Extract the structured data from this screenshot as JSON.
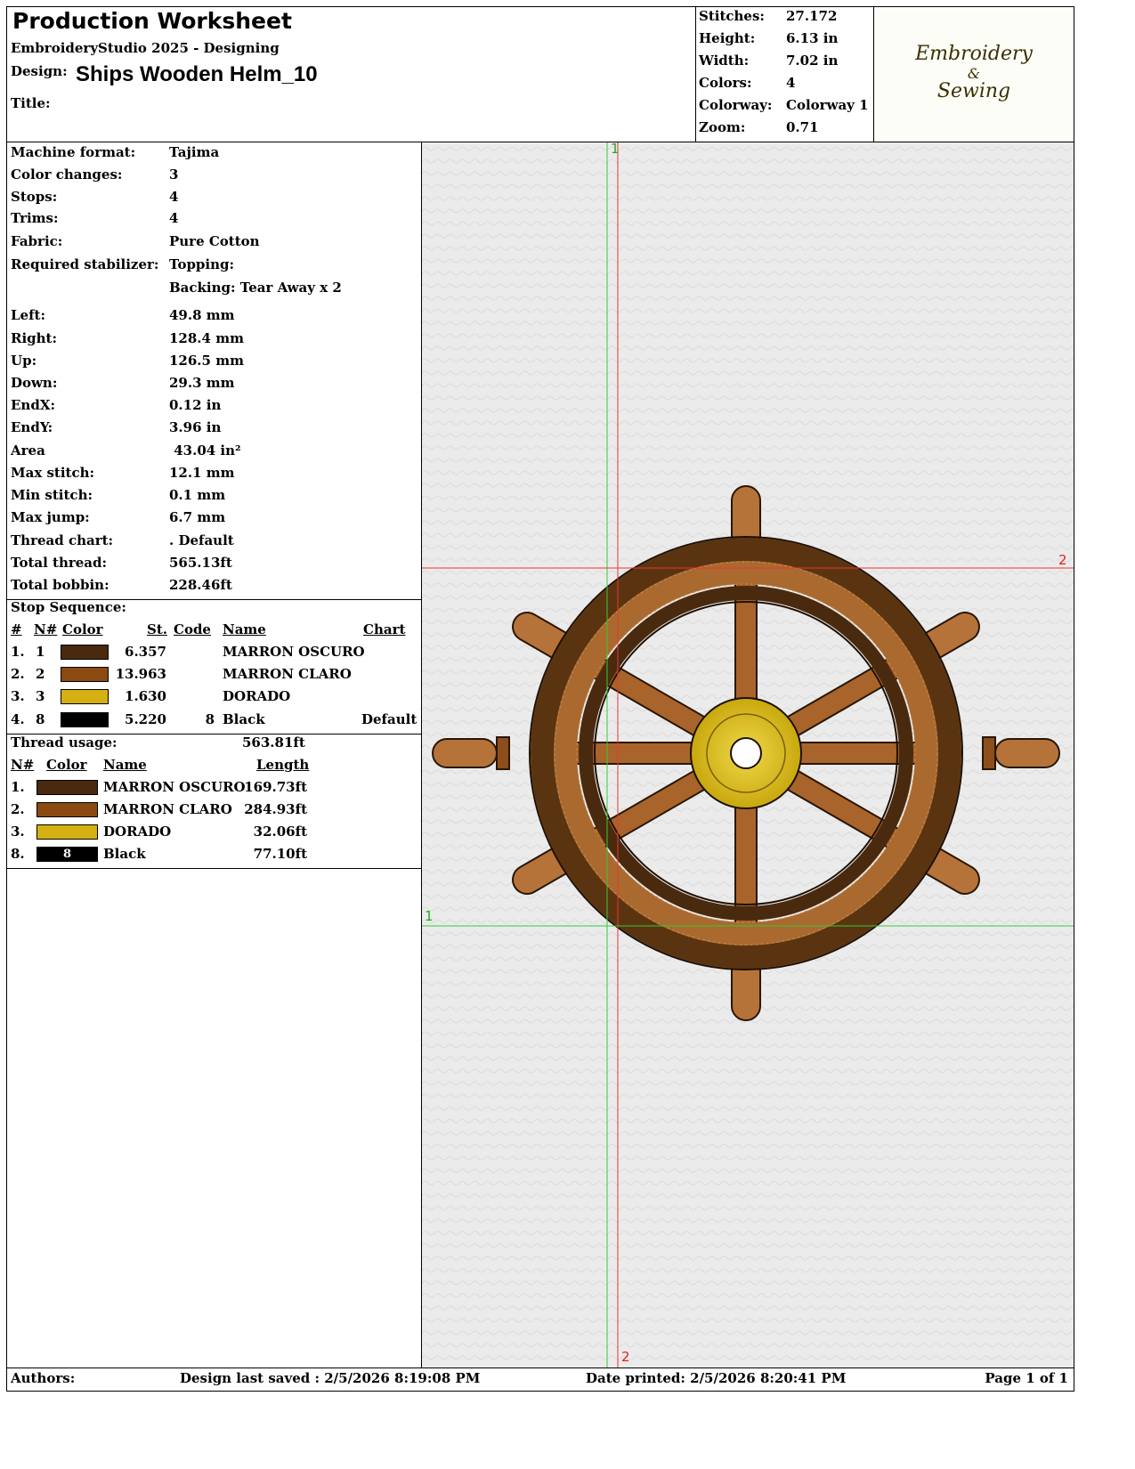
{
  "header": {
    "title": "Production Worksheet",
    "software": "EmbroideryStudio 2025 - Designing",
    "design_label": "Design:",
    "design_name": "Ships Wooden Helm_10",
    "title_label": "Title:",
    "title_value": ""
  },
  "summary": [
    {
      "label": "Stitches:",
      "value": "27.172"
    },
    {
      "label": "Height:",
      "value": "6.13 in"
    },
    {
      "label": "Width:",
      "value": "7.02 in"
    },
    {
      "label": "Colors:",
      "value": "4"
    },
    {
      "label": "Colorway:",
      "value": "Colorway 1"
    },
    {
      "label": "Zoom:",
      "value": "0.71"
    }
  ],
  "logo": {
    "line1": "Embroidery",
    "line2": "&",
    "line3": "Sewing"
  },
  "details": [
    {
      "label": "Machine format:",
      "value": "Tajima"
    },
    {
      "label": "Color changes:",
      "value": "3"
    },
    {
      "label": "Stops:",
      "value": "4"
    },
    {
      "label": "Trims:",
      "value": "4"
    },
    {
      "label": "Fabric:",
      "value": "Pure Cotton"
    },
    {
      "label": "Required stabilizer:",
      "value": "Topping:"
    },
    {
      "label": "",
      "value": "Backing: Tear Away x 2"
    },
    {
      "label": "Left:",
      "value": "49.8 mm"
    },
    {
      "label": "Right:",
      "value": "128.4 mm"
    },
    {
      "label": "Up:",
      "value": "126.5 mm"
    },
    {
      "label": "Down:",
      "value": "29.3 mm"
    },
    {
      "label": "EndX:",
      "value": "0.12 in"
    },
    {
      "label": "EndY:",
      "value": "3.96 in"
    },
    {
      "label": "Area",
      "value": " 43.04 in²"
    },
    {
      "label": "Max stitch:",
      "value": "12.1 mm"
    },
    {
      "label": "Min stitch:",
      "value": "0.1 mm"
    },
    {
      "label": "Max jump:",
      "value": "6.7 mm"
    },
    {
      "label": "Thread chart:",
      "value": ". Default"
    },
    {
      "label": "Total thread:",
      "value": "565.13ft"
    },
    {
      "label": "Total bobbin:",
      "value": "228.46ft"
    }
  ],
  "stop_sequence": {
    "title": "Stop Sequence:",
    "headers": {
      "num": "#",
      "n": "N#",
      "color": "Color",
      "st": "St.",
      "code": "Code",
      "name": "Name",
      "chart": "Chart"
    },
    "rows": [
      {
        "num": "1.",
        "n": "1",
        "color": "#4a2a0e",
        "st": "6.357",
        "code": "",
        "name": "MARRON OSCURO",
        "chart": ""
      },
      {
        "num": "2.",
        "n": "2",
        "color": "#8a4a12",
        "st": "13.963",
        "code": "",
        "name": "MARRON CLARO",
        "chart": ""
      },
      {
        "num": "3.",
        "n": "3",
        "color": "#d4b012",
        "st": "1.630",
        "code": "",
        "name": "DORADO",
        "chart": ""
      },
      {
        "num": "4.",
        "n": "8",
        "color": "#000000",
        "st": "5.220",
        "code": "8",
        "name": "Black",
        "chart": "Default"
      }
    ]
  },
  "thread_usage": {
    "title": "Thread usage:",
    "total": "563.81ft",
    "headers": {
      "n": "N#",
      "color": "Color",
      "name": "Name",
      "length": "Length"
    },
    "rows": [
      {
        "n": "1.",
        "color": "#4a2a0e",
        "swatch_text": "",
        "name": "MARRON OSCURO",
        "length": "169.73ft"
      },
      {
        "n": "2.",
        "color": "#8a4a12",
        "swatch_text": "",
        "name": "MARRON CLARO",
        "length": "284.93ft"
      },
      {
        "n": "3.",
        "color": "#d4b012",
        "swatch_text": "",
        "name": "DORADO",
        "length": "32.06ft"
      },
      {
        "n": "8.",
        "color": "#000000",
        "swatch_text": "8",
        "name": "Black",
        "length": "77.10ft"
      }
    ]
  },
  "preview": {
    "markers": [
      "1",
      "2",
      "1",
      "2"
    ]
  },
  "footer": {
    "authors": "Authors:",
    "saved": "Design last saved : 2/5/2026 8:19:08 PM",
    "printed": "Date printed: 2/5/2026 8:20:41 PM",
    "page": "Page 1 of 1"
  }
}
